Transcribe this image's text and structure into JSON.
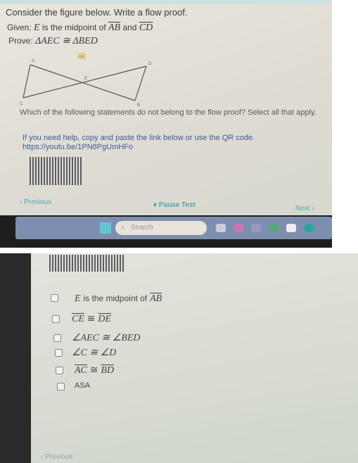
{
  "question": {
    "instruction": "Consider the figure below. Write a flow proof.",
    "given_label": "Given:",
    "given_point": "E",
    "given_text": "is the midpoint of",
    "given_seg1": "AB",
    "given_and": "and",
    "given_seg2": "CD",
    "prove_label": "Prove:",
    "prove_statement": "ΔAEC ≅ ΔBED",
    "figure_labels": {
      "A": "A",
      "B": "B",
      "C": "C",
      "D": "D",
      "E": "E",
      "badge": "cnj"
    },
    "prompt": "Which of the following statements do not belong to the flow proof? Select all that apply.",
    "help_text": "If you need help, copy and paste the link below or use the QR code.",
    "help_link": "https://youtu.be/1PN8PgUmHFo"
  },
  "nav": {
    "previous": "Previous",
    "pause": "Pause Test",
    "next": "Next"
  },
  "taskbar": {
    "search_placeholder": "Search"
  },
  "options": [
    {
      "point": "E",
      "text": "is the midpoint of",
      "seg": "AB",
      "checked": false
    },
    {
      "a": "CE",
      "rel": "≅",
      "b": "DE",
      "checked": false
    },
    {
      "text": "∠AEC ≅ ∠BED",
      "checked": false
    },
    {
      "text": "∠C ≅ ∠D",
      "checked": false
    },
    {
      "a": "AC",
      "rel": "≅",
      "b": "BD",
      "checked": false
    },
    {
      "text": "ASA",
      "checked": false
    }
  ],
  "colors": {
    "accent": "#4aa9b8",
    "taskbar": "#7d8fb0"
  }
}
